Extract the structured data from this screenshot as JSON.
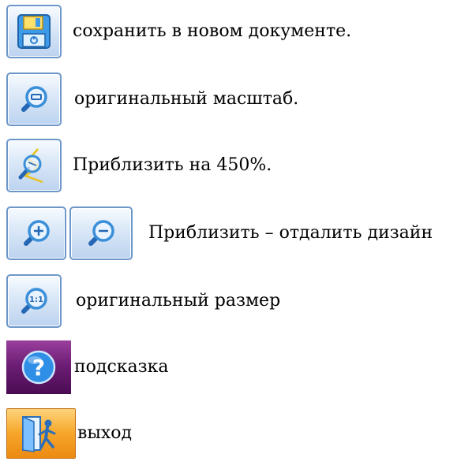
{
  "items": [
    {
      "icon": "floppy-disk-icon",
      "label": "сохранить в новом документе."
    },
    {
      "icon": "zoom-original-scale-icon",
      "label": "оригинальный масштаб."
    },
    {
      "icon": "zoom-450-icon",
      "label": "Приблизить на 450%."
    },
    {
      "icons": [
        "zoom-in-icon",
        "zoom-out-icon"
      ],
      "label": "Приблизить – отдалить дизайн"
    },
    {
      "icon": "zoom-1-1-icon",
      "label": "оригинальный размер",
      "icon_text": "1:1"
    },
    {
      "icon": "help-question-icon",
      "label": "подсказка",
      "icon_text": "?"
    },
    {
      "icon": "exit-door-icon",
      "label": "выход"
    }
  ],
  "colors": {
    "button_border": "#6d97c9",
    "button_fill": "#bcd3ef",
    "magnifier_lens": "#3a8fd8",
    "help_fill": "#6d1e75",
    "exit_fill": "#f6a629"
  }
}
